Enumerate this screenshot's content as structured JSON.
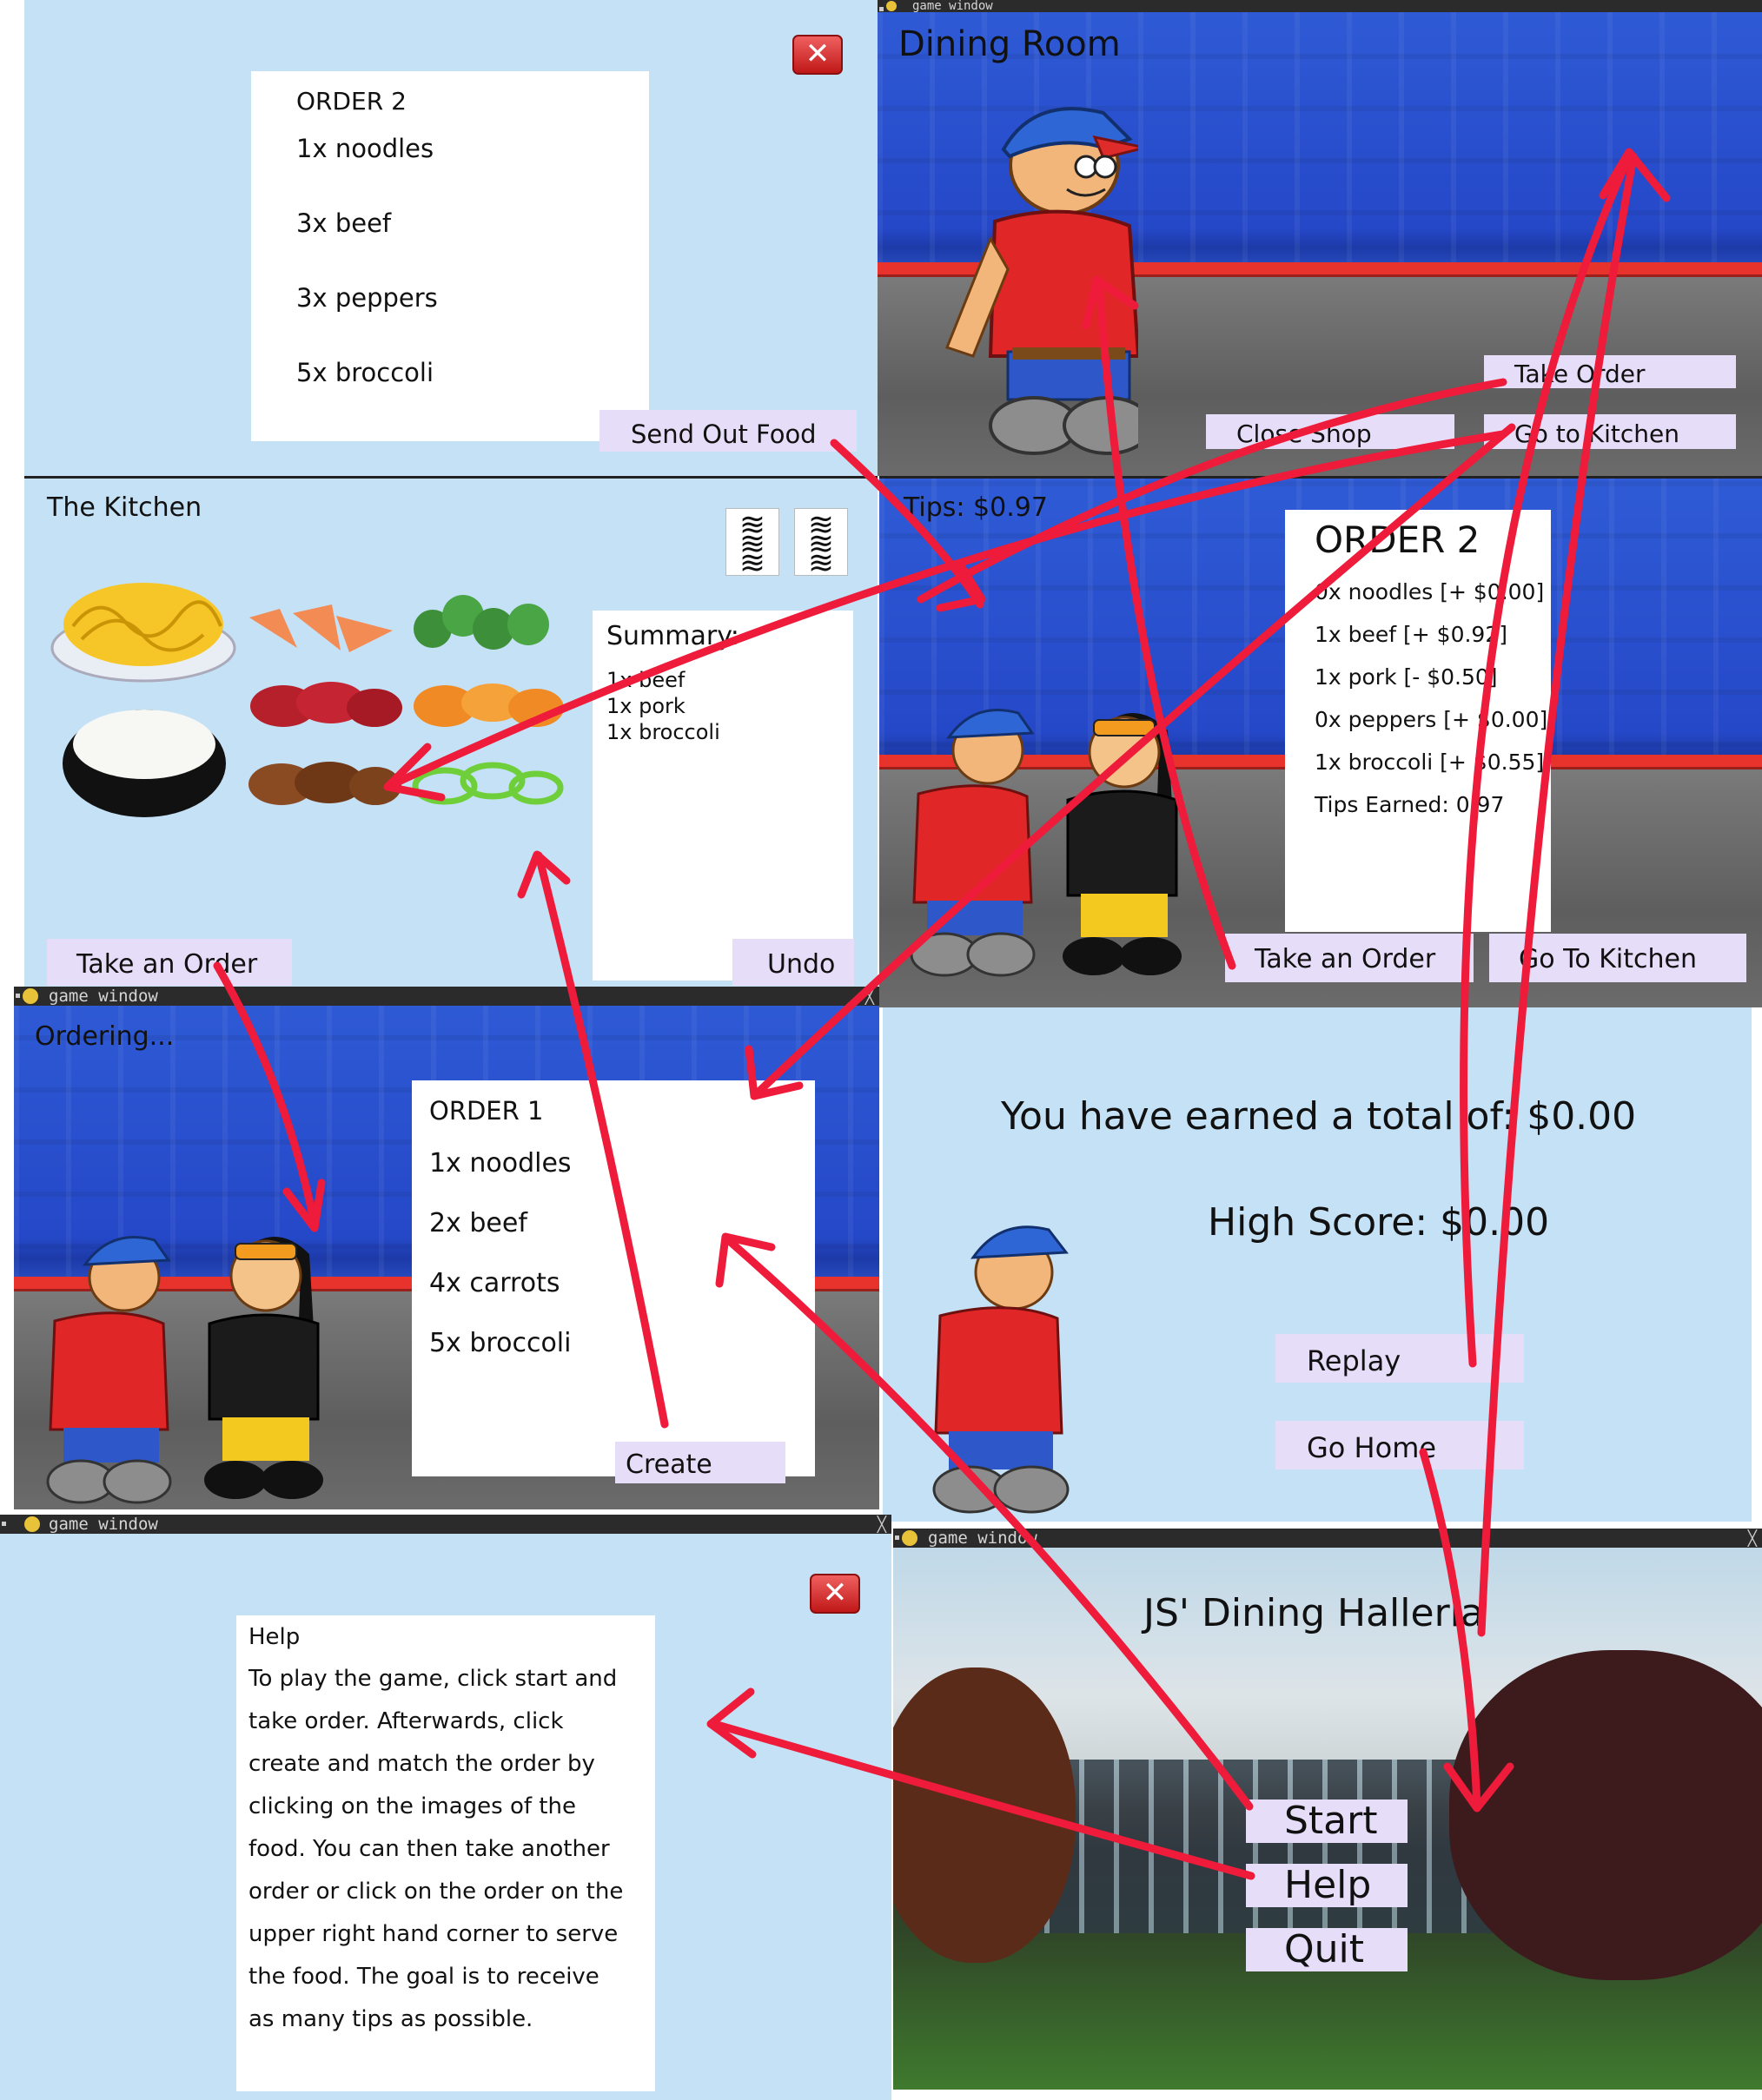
{
  "send_out_panel": {
    "order_title": "ORDER 2",
    "items": [
      "1x noodles",
      "3x beef",
      "3x peppers",
      "5x broccoli"
    ],
    "send_button": "Send Out Food"
  },
  "dining_room": {
    "window_title": "game window",
    "title": "Dining Room",
    "take_order_button": "Take Order",
    "close_shop_button": "Close Shop",
    "go_to_kitchen_button": "Go to Kitchen"
  },
  "kitchen": {
    "title": "The Kitchen",
    "summary_title": "Summary:",
    "summary_lines": [
      "1x beef",
      "1x pork",
      "1x broccoli"
    ],
    "take_order_button": "Take an Order",
    "undo_button": "Undo"
  },
  "tips_screen": {
    "tips_label": "Tips: $0.97",
    "order_title": "ORDER 2",
    "lines": [
      "0x noodles [+ $0.00]",
      "1x beef [+ $0.92]",
      "1x pork [- $0.50]",
      "0x peppers [+ $0.00]",
      "1x broccoli [+ $0.55]",
      "Tips Earned: 0.97"
    ],
    "take_order_button": "Take an Order",
    "go_to_kitchen_button": "Go To Kitchen"
  },
  "ordering": {
    "window_title": "game window",
    "title": "Ordering...",
    "order_title": "ORDER 1",
    "items": [
      "1x noodles",
      "2x beef",
      "4x carrots",
      "5x broccoli"
    ],
    "create_button": "Create"
  },
  "end_screen": {
    "total_text": "You have earned a total of: $0.00",
    "high_score_text": "High Score: $0.00",
    "replay_button": "Replay",
    "go_home_button": "Go Home"
  },
  "help_panel": {
    "window_title": "game window",
    "title": "Help",
    "lines": [
      "To play the game, click start and",
      "take order. Afterwards, click",
      "create and match the order by",
      "clicking on the images of the",
      "food. You can then take another",
      "order or click on the order on the",
      "upper right hand corner to serve",
      "the food. The goal is to receive",
      "as many tips as possible."
    ]
  },
  "home_screen": {
    "window_title": "game window",
    "title": "JS' Dining Halleria",
    "start_button": "Start",
    "help_button": "Help",
    "quit_button": "Quit"
  },
  "colors": {
    "panel_bg": "#c5e1f5",
    "button_bg": "#e6def9",
    "dining_blue": "#2f5bd6",
    "arrow_red": "#ee1b3a"
  },
  "icons": [
    "close-icon",
    "pygame-icon",
    "ticket-icon",
    "noodles-icon",
    "rice-icon",
    "salmon-icon",
    "beef-icon",
    "pork-icon",
    "broccoli-icon",
    "carrots-icon",
    "peppers-icon"
  ]
}
